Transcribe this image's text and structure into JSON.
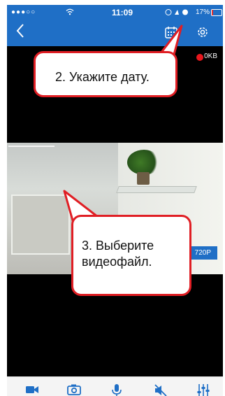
{
  "status_bar": {
    "signal": "●●●○○",
    "time": "11:09",
    "battery_percent": "17%",
    "battery_level": 0.17,
    "battery_color": "#e33333"
  },
  "nav_bar": {
    "back_icon": "chevron-left-icon",
    "calendar_icon": "calendar-icon",
    "settings_icon": "gear-icon",
    "bar_color": "#1f6fc6"
  },
  "recording": {
    "dot_color": "#e8171d",
    "size_text": "0KB"
  },
  "video": {
    "resolution": "720P"
  },
  "callouts": {
    "date_hint": "2. Укажите дату.",
    "file_hint_line1": "3. Выберите",
    "file_hint_line2": "видеофайл.",
    "border_color": "#e01e24"
  },
  "toolbar": {
    "icons": [
      "video-camera-icon",
      "camera-icon",
      "microphone-icon",
      "speaker-muted-icon",
      "equalizer-icon"
    ],
    "icon_color": "#1f6fc6"
  }
}
